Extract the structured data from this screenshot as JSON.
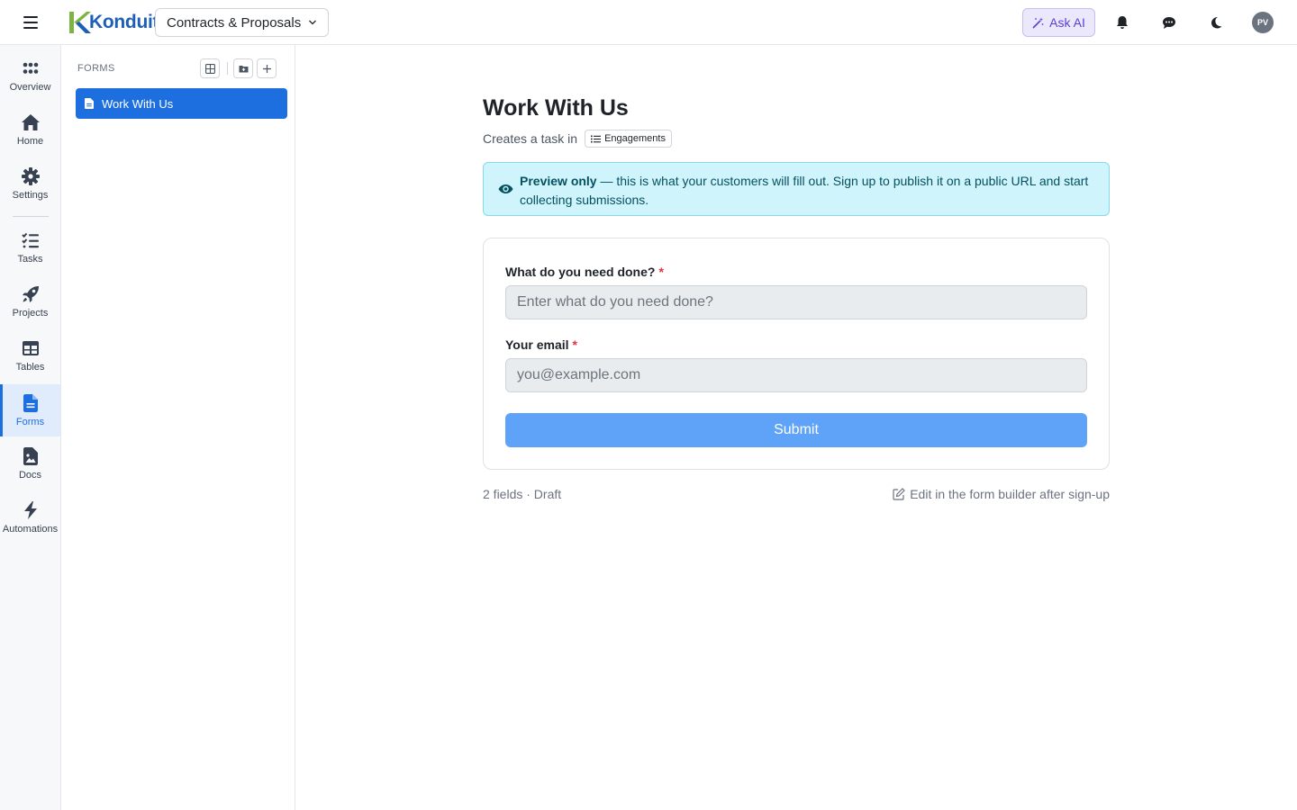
{
  "app": {
    "name": "Konduit",
    "workspace": "Contracts & Proposals"
  },
  "topbar": {
    "ask_ai_label": "Ask AI",
    "avatar_initials": "PV"
  },
  "rail": {
    "items": [
      {
        "label": "Overview",
        "icon": "grid-dots-icon"
      },
      {
        "label": "Home",
        "icon": "home-icon"
      },
      {
        "label": "Settings",
        "icon": "gear-icon"
      },
      {
        "label": "Tasks",
        "icon": "checklist-icon"
      },
      {
        "label": "Projects",
        "icon": "rocket-icon"
      },
      {
        "label": "Tables",
        "icon": "table-icon"
      },
      {
        "label": "Forms",
        "icon": "form-icon",
        "active": true
      },
      {
        "label": "Docs",
        "icon": "doc-image-icon"
      },
      {
        "label": "Automations",
        "icon": "lightning-icon"
      }
    ]
  },
  "panel": {
    "title": "FORMS",
    "items": [
      {
        "label": "Work With Us",
        "active": true
      }
    ]
  },
  "form": {
    "title": "Work With Us",
    "creates_task_prefix": "Creates a task in",
    "target_list": "Engagements",
    "banner_strong": "Preview only",
    "banner_text": "— this is what your customers will fill out. Sign up to publish it on a public URL and start collecting submissions.",
    "fields": [
      {
        "label": "What do you need done?",
        "required_mark": "*",
        "placeholder": "Enter what do you need done?"
      },
      {
        "label": "Your email",
        "required_mark": "*",
        "placeholder": "you@example.com"
      }
    ],
    "submit_label": "Submit",
    "meta": "2 fields · Draft",
    "edit_hint": "Edit in the form builder after sign-up"
  },
  "colors": {
    "accent": "#1d6fe0",
    "submit": "#5fa3f8",
    "banner_bg": "#cff4fc",
    "ask_ai": "#5b3fd4",
    "required": "#dc3545"
  }
}
